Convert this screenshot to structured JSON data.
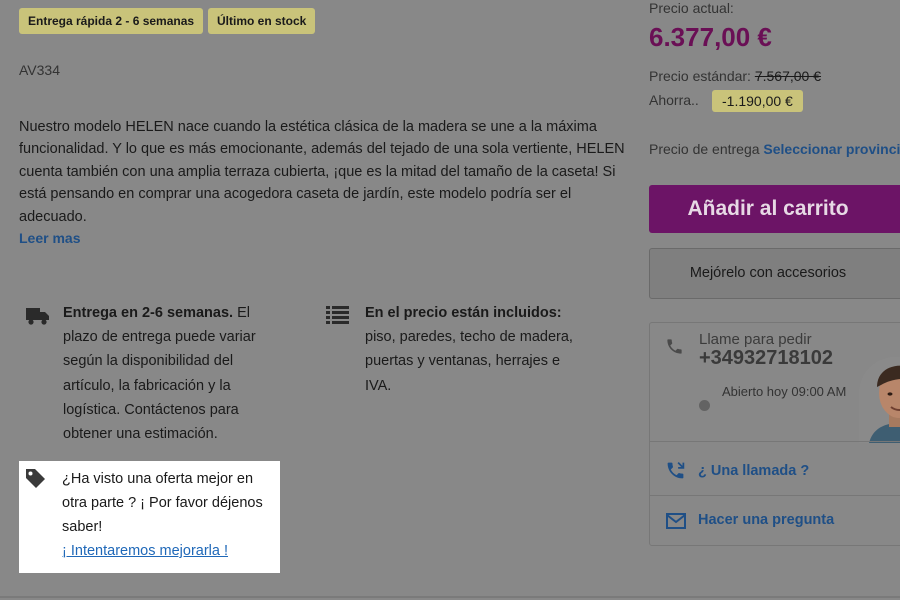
{
  "badges": {
    "fast_delivery": "Entrega rápida 2 - 6 semanas",
    "last_stock": "Último en stock"
  },
  "product": {
    "sku": "AV334",
    "description": "Nuestro modelo HELEN nace cuando la estética clásica de la madera se une a la máxima funcionalidad. Y lo que es más emocionante, además del tejado de una sola vertiente, HELEN cuenta también con una amplia terraza cubierta, ¡que es la mitad del tamaño de la caseta! Si está pensando en comprar una acogedora caseta de jardín, este modelo podría ser el adecuado.",
    "read_more": "Leer mas"
  },
  "features": {
    "delivery_title": "Entrega en 2-6 semanas.",
    "delivery_text": " El plazo de entrega puede variar según la disponibilidad del artículo, la fabricación y la logística. Contáctenos para obtener una estimación.",
    "included_title": "En el precio están incluidos:",
    "included_text": " piso, paredes, techo de madera, puertas y ventanas, herrajes e IVA."
  },
  "offer": {
    "text": "¿Ha visto una oferta mejor en otra parte ? ¡ Por favor déjenos saber!",
    "link": "¡ Intentaremos mejorarla !"
  },
  "pricing": {
    "current_label": "Precio actual:",
    "current_price": "6.377,00 €",
    "standard_label": "Precio estándar:",
    "standard_price": "7.567,00 €",
    "save_label": "Ahorra..",
    "save_amount": "-1.190,00 €",
    "delivery_label": "Precio de entrega",
    "delivery_link": "Seleccionar provincia"
  },
  "actions": {
    "add_to_cart": "Añadir al carrito",
    "accessories": "Mejórelo con accesorios"
  },
  "contact": {
    "call_label": "Llame para pedir",
    "phone": "+34932718102",
    "open_hours": "Abierto hoy 09:00 AM",
    "callback": "¿ Una llamada ?",
    "ask_question": "Hacer una pregunta"
  },
  "colors": {
    "background_overlay": "#888888",
    "price_accent": "#6a0f55",
    "cart_button": "#6c1466",
    "badge": "#c9c37a",
    "link": "#1f4f86"
  },
  "icons": {
    "delivery": "truck-icon",
    "included": "list-icon",
    "offer": "price-tag-icon",
    "call": "phone-icon",
    "callback": "phone-callback-icon",
    "question": "mail-icon",
    "status": "status-dot"
  }
}
